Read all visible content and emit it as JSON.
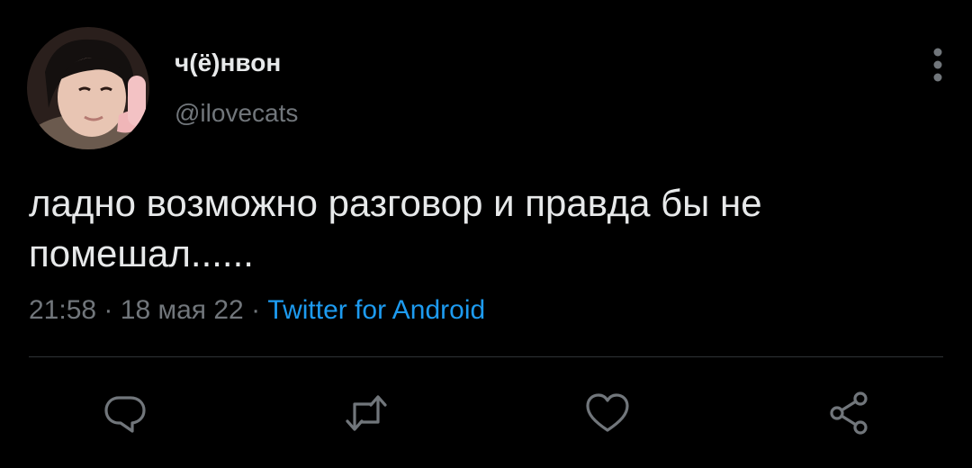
{
  "tweet": {
    "display_name": "ч(ё)нвон",
    "handle": "@ilovecats",
    "text": "ладно возможно разговор и правда бы не помешал......",
    "time": "21:58",
    "separator": "·",
    "date": "18 мая 22",
    "source": "Twitter for Android"
  },
  "icons": {
    "more": "more-vertical-icon",
    "reply": "reply-icon",
    "retweet": "retweet-icon",
    "like": "like-icon",
    "share": "share-icon"
  },
  "colors": {
    "background": "#000000",
    "primary_text": "#e7e9ea",
    "secondary_text": "#71767b",
    "accent": "#1d9bf0",
    "divider": "#2f3336"
  }
}
